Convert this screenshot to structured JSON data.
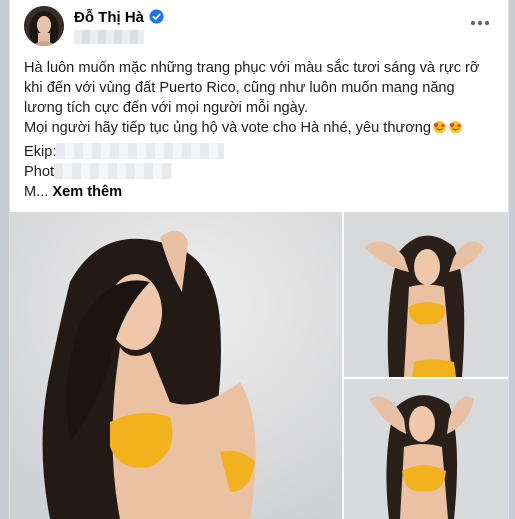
{
  "post": {
    "author": "Đỗ Thị Hà",
    "line1": "Hà luôn muốn mặc những trang phục với màu sắc tươi sáng và rực rỡ",
    "line2": "khi đến với vùng đất Puerto Rico, cũng như luôn muốn mang năng",
    "line3": "lương tích cực đến với mọi người mỗi ngày.",
    "line4": "Mọi người hãy tiếp tục ủng hộ và vote cho Hà nhé, yêu thương",
    "ekip_label": "Ekip:",
    "photo_label": "Phot",
    "m_label": "M...",
    "see_more": "Xem thêm"
  },
  "icons": {
    "verified": "verified-badge-icon",
    "more": "more-options-icon",
    "emoji": "smiling-face-with-hearts-icon"
  },
  "colors": {
    "accent": "#1877f2",
    "swimsuit": "#f2b21d"
  }
}
